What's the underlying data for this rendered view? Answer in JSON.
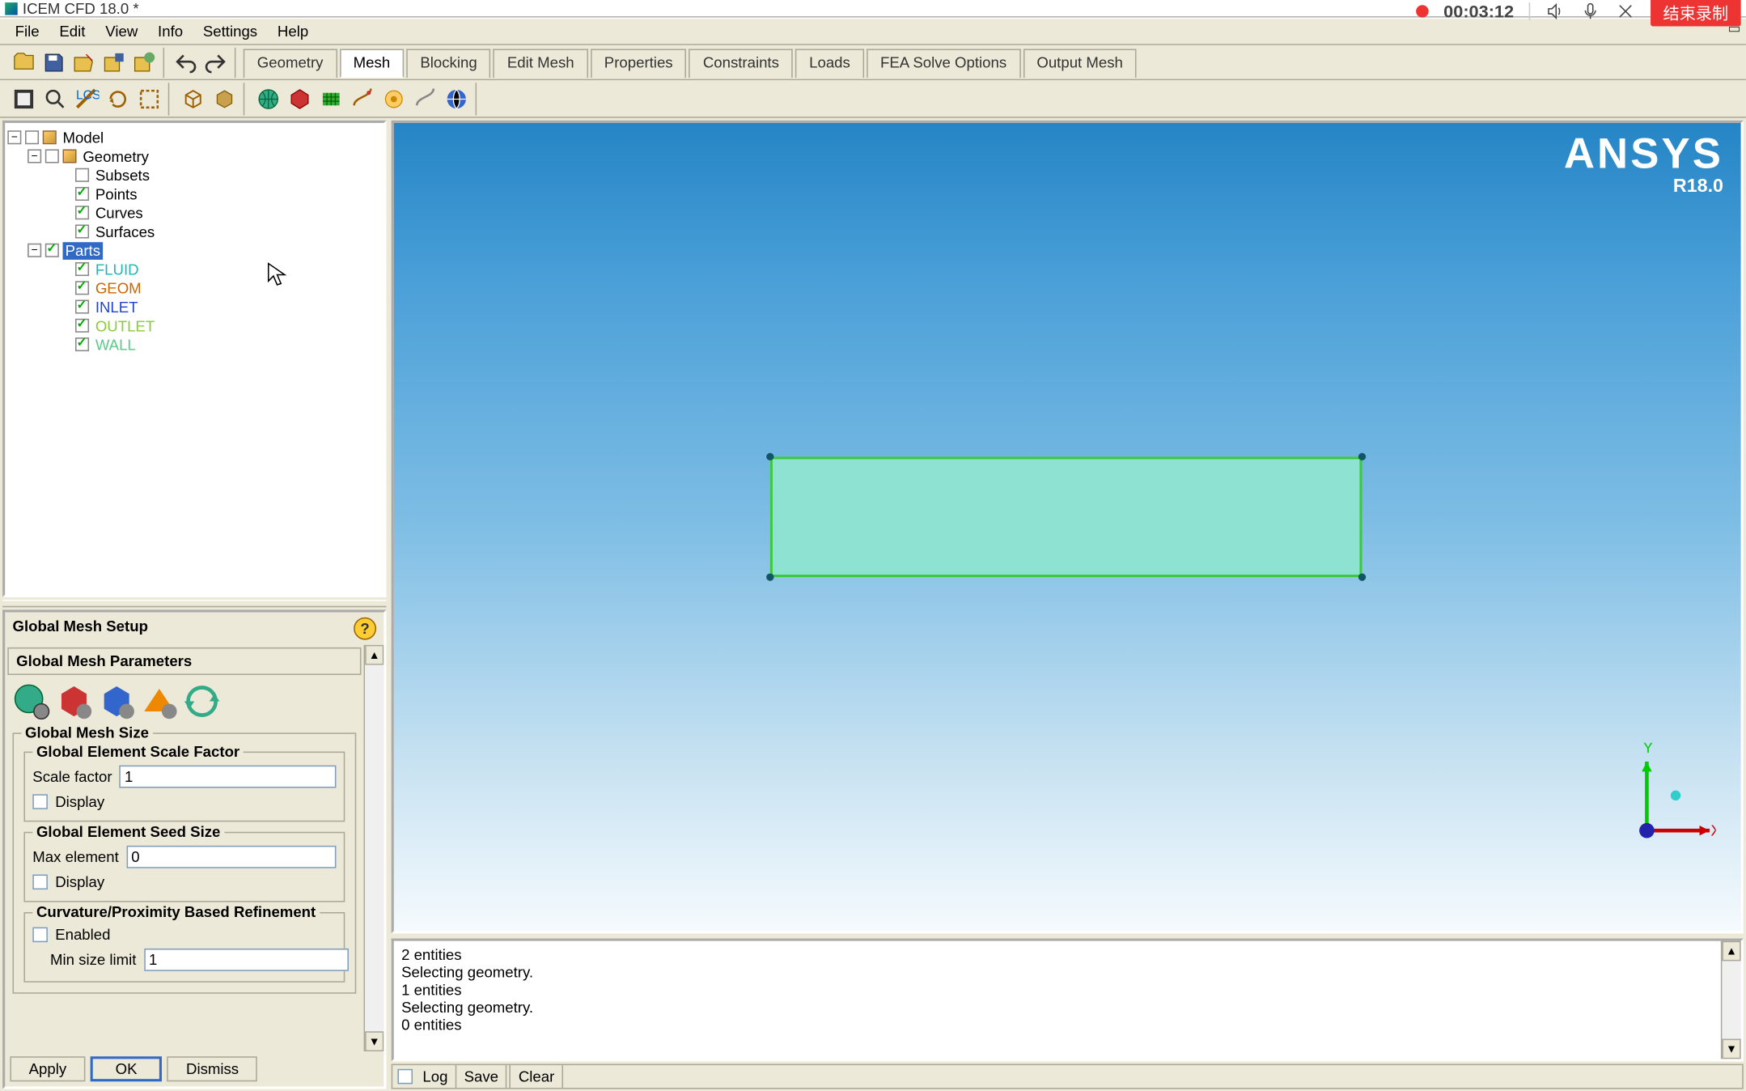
{
  "title": "ICEM CFD 18.0 *",
  "recorder": {
    "time": "00:03:12",
    "stop": "结束录制"
  },
  "menu": [
    "File",
    "Edit",
    "View",
    "Info",
    "Settings",
    "Help"
  ],
  "ribbon_tabs": [
    "Geometry",
    "Mesh",
    "Blocking",
    "Edit Mesh",
    "Properties",
    "Constraints",
    "Loads",
    "FEA Solve Options",
    "Output Mesh"
  ],
  "active_tab": "Mesh",
  "tree": {
    "root": "Model",
    "geometry": {
      "label": "Geometry",
      "children": [
        {
          "label": "Subsets",
          "checked": false,
          "color": "#000"
        },
        {
          "label": "Points",
          "checked": true,
          "color": "#000"
        },
        {
          "label": "Curves",
          "checked": true,
          "color": "#000"
        },
        {
          "label": "Surfaces",
          "checked": true,
          "color": "#000"
        }
      ]
    },
    "parts": {
      "label": "Parts",
      "selected": true,
      "children": [
        {
          "label": "FLUID",
          "checked": true,
          "color": "#22b5b5"
        },
        {
          "label": "GEOM",
          "checked": true,
          "color": "#cc6600"
        },
        {
          "label": "INLET",
          "checked": true,
          "color": "#2244cc"
        },
        {
          "label": "OUTLET",
          "checked": true,
          "color": "#88cc33"
        },
        {
          "label": "WALL",
          "checked": true,
          "color": "#55cc88"
        }
      ]
    }
  },
  "panel": {
    "title": "Global Mesh Setup",
    "section": "Global Mesh Parameters",
    "box1": "Global Mesh Size",
    "box2": "Global Element Scale Factor",
    "scale_label": "Scale factor",
    "scale_value": "1",
    "display": "Display",
    "box3": "Global Element Seed Size",
    "max_label": "Max element",
    "max_value": "0",
    "box4": "Curvature/Proximity Based Refinement",
    "enabled": "Enabled",
    "minsize_label": "Min size limit",
    "minsize_value": "1",
    "apply": "Apply",
    "ok": "OK",
    "dismiss": "Dismiss"
  },
  "brand": {
    "name": "ANSYS",
    "ver": "R18.0"
  },
  "triad": {
    "x": "X",
    "y": "Y"
  },
  "messages": [
    "2 entities",
    "Selecting geometry.",
    "1 entities",
    "Selecting geometry.",
    "0 entities"
  ],
  "msgbtns": {
    "log": "Log",
    "save": "Save",
    "clear": "Clear"
  }
}
